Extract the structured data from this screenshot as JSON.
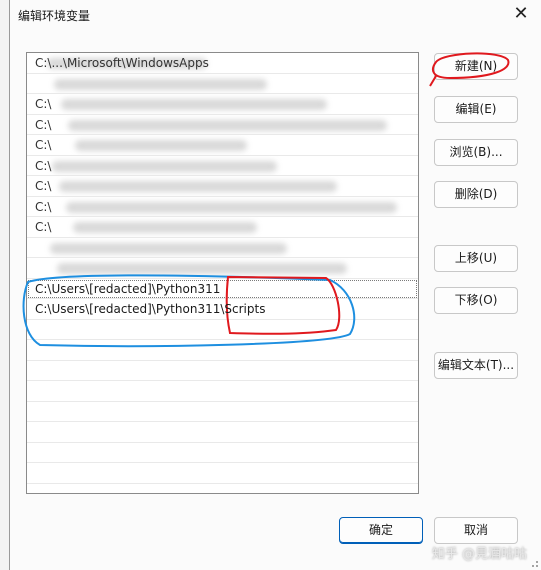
{
  "window": {
    "title": "编辑环境变量",
    "close_glyph": "✕"
  },
  "path_list": {
    "rows": [
      {
        "text": "C:\\...\\Microsoft\\WindowsApps",
        "blurred": true
      },
      {
        "text": "",
        "blurred": true
      },
      {
        "text": "C:\\",
        "blurred": true
      },
      {
        "text": "C:\\",
        "blurred": true
      },
      {
        "text": "C:\\",
        "blurred": true
      },
      {
        "text": "C:\\",
        "blurred": true
      },
      {
        "text": "C:\\",
        "blurred": true
      },
      {
        "text": "C:\\",
        "blurred": true
      },
      {
        "text": "C:\\",
        "blurred": true
      },
      {
        "text": "",
        "blurred": true
      },
      {
        "text": "",
        "blurred": true
      },
      {
        "text": "C:\\Users\\[redacted]\\Python311",
        "blurred": false,
        "selected": true
      },
      {
        "text": "C:\\Users\\[redacted]\\Python311\\Scripts",
        "blurred": false
      },
      {
        "text": "",
        "blurred": false
      },
      {
        "text": "",
        "blurred": false
      },
      {
        "text": "",
        "blurred": false
      },
      {
        "text": "",
        "blurred": false
      },
      {
        "text": "",
        "blurred": false
      },
      {
        "text": "",
        "blurred": false
      },
      {
        "text": "",
        "blurred": false
      },
      {
        "text": "",
        "blurred": false
      }
    ]
  },
  "buttons": {
    "new": "新建(N)",
    "edit": "编辑(E)",
    "browse": "浏览(B)...",
    "delete": "删除(D)",
    "move_up": "上移(U)",
    "move_down": "下移(O)",
    "edit_text": "编辑文本(T)...",
    "ok": "确定",
    "cancel": "取消"
  },
  "watermark": "知乎 @見酒咕咕",
  "colors": {
    "annotation_red": "#e0191e",
    "annotation_blue": "#1e8fe0",
    "accent": "#005fb8"
  }
}
